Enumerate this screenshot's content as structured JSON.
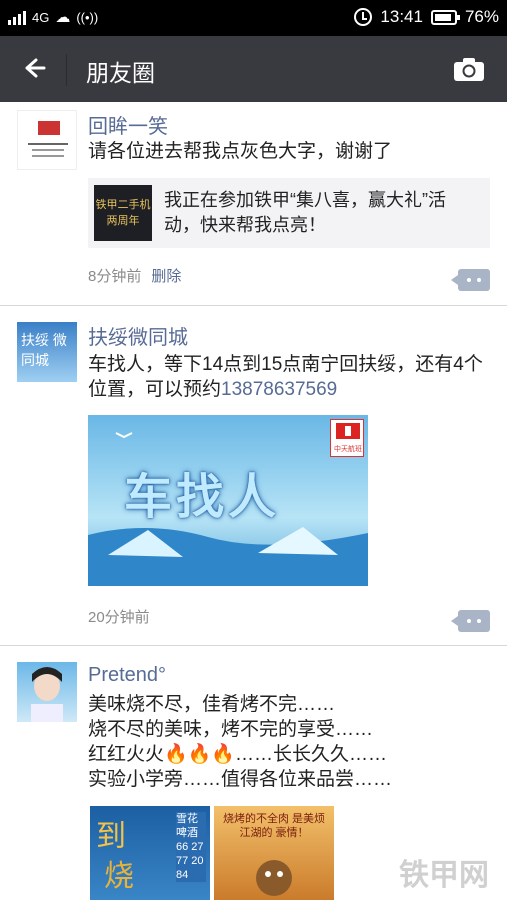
{
  "status_bar": {
    "network": "4G",
    "time": "13:41",
    "battery": "76%"
  },
  "header": {
    "title": "朋友圈"
  },
  "posts": [
    {
      "name": "回眸一笑",
      "text": "请各位进去帮我点灰色大字，谢谢了",
      "share_thumb": "铁甲二手机 两周年",
      "share_text": "我正在参加铁甲“集八喜，赢大礼”活动，快来帮我点亮！",
      "time": "8分钟前",
      "delete_label": "删除"
    },
    {
      "name": "扶绥微同城",
      "avatar_text": "扶绥 微同城",
      "text": "车找人，等下14点到15点南宁回扶绥，还有4个位置，可以预约",
      "phone": "13878637569",
      "image_text": "车找人",
      "image_logo_text": "中天航班",
      "time": "20分钟前"
    },
    {
      "name": "Pretend°",
      "lines": [
        "美味烧不尽，佳肴烤不完……",
        "烧不尽的美味，烤不完的享受……",
        "红红火火🔥🔥🔥……长长久久……",
        "实验小学旁……值得各位来品尝……"
      ],
      "pic1_text": "雪花啤酒 66 27 77 20 84",
      "pic2_text": "烧烤的不全肉 是美烦江湖的 豪情！"
    }
  ],
  "watermark": "铁甲网"
}
